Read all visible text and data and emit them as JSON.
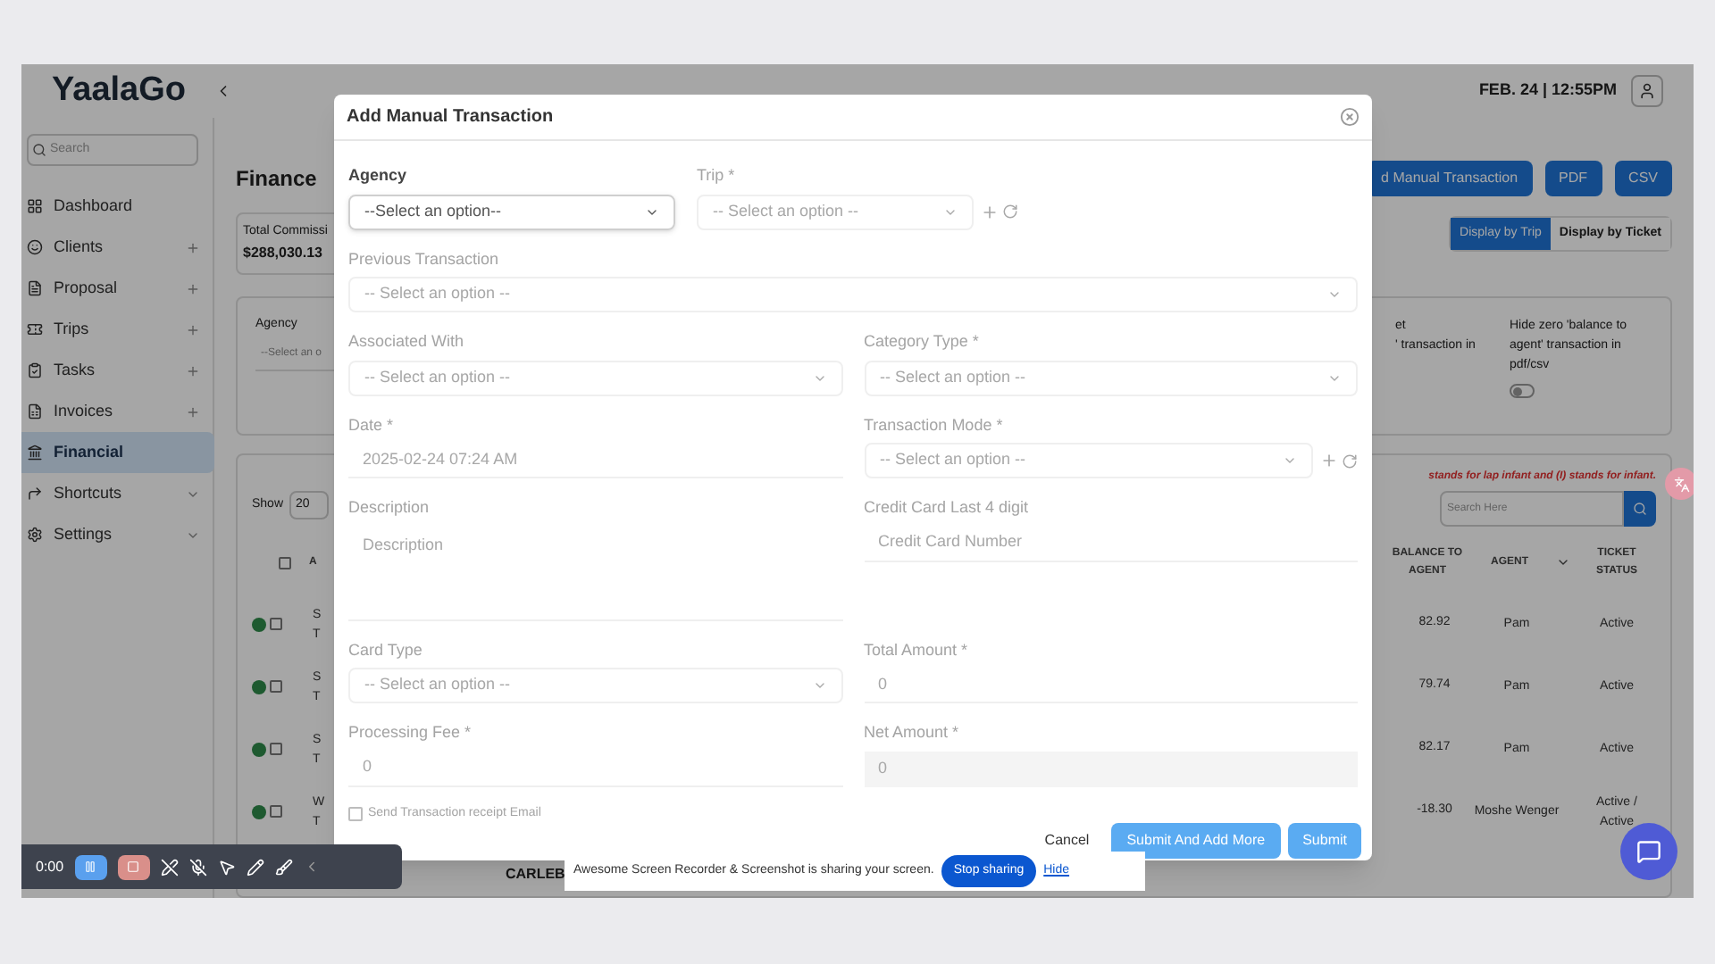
{
  "header": {
    "logo": "YaalaGo",
    "datetime": "FEB. 24 | 12:55PM"
  },
  "sidebar": {
    "search_placeholder": "Search",
    "items": [
      {
        "label": "Dashboard",
        "selected": false,
        "kind": "plain"
      },
      {
        "label": "Clients",
        "selected": false,
        "kind": "plus"
      },
      {
        "label": "Proposal",
        "selected": false,
        "kind": "plus"
      },
      {
        "label": "Trips",
        "selected": false,
        "kind": "plus"
      },
      {
        "label": "Tasks",
        "selected": false,
        "kind": "plus"
      },
      {
        "label": "Invoices",
        "selected": false,
        "kind": "plus"
      },
      {
        "label": "Financial",
        "selected": true,
        "kind": "plain"
      },
      {
        "label": "Shortcuts",
        "selected": false,
        "kind": "dropdown"
      },
      {
        "label": "Settings",
        "selected": false,
        "kind": "dropdown"
      }
    ]
  },
  "page": {
    "title": "Finance",
    "actions": [
      "d Manual Transaction",
      "PDF",
      "CSV"
    ],
    "stat": {
      "label": "Total Commissi",
      "value": "$288,030.13"
    },
    "display_tabs": [
      {
        "label": "Display by Trip",
        "selected": true
      },
      {
        "label": "Display by Ticket",
        "selected": false
      }
    ]
  },
  "filters": {
    "agency_label": "Agency",
    "agency_value": "--Select an o",
    "cut_note": [
      "et",
      "' transaction in"
    ],
    "hide_zero": {
      "label": "Hide zero 'balance to agent' transaction in pdf/csv",
      "on": false
    }
  },
  "table": {
    "show_label": "Show",
    "page_size": "20",
    "legend": "stands for lap infant and (I) stands for infant.",
    "search_placeholder": "Search Here",
    "header_checked": false,
    "columns": [
      "A",
      "BALANCE TO AGENT",
      "AGENT",
      "TICKET STATUS"
    ],
    "rows": [
      {
        "checked": false,
        "col_a": [
          "S",
          "T"
        ],
        "balance": "82.92",
        "agent": "Pam",
        "status": "Active"
      },
      {
        "checked": false,
        "col_a": [
          "S",
          "T"
        ],
        "balance": "79.74",
        "agent": "Pam",
        "status": "Active"
      },
      {
        "checked": false,
        "col_a": [
          "S",
          "T"
        ],
        "balance": "82.17",
        "agent": "Pam",
        "status": "Active"
      },
      {
        "checked": false,
        "col_a": [
          "W",
          "T"
        ],
        "balance": "-18.30",
        "agent": "Moshe Wenger",
        "status": "Active / Active"
      }
    ]
  },
  "modal": {
    "title": "Add Manual Transaction",
    "rows": [
      [
        {
          "label": "Agency",
          "kind": "select",
          "placeholder": "--Select an option--",
          "focused": true
        },
        {
          "label": "Trip *",
          "kind": "select",
          "placeholder": "-- Select an option --",
          "focused": false,
          "actions": true
        }
      ],
      [
        {
          "label": "Previous Transaction",
          "kind": "select",
          "placeholder": "-- Select an option --",
          "focused": false
        }
      ],
      [
        {
          "label": "Associated With",
          "kind": "select",
          "placeholder": "-- Select an option --",
          "focused": false
        },
        {
          "label": "Category Type *",
          "kind": "select",
          "placeholder": "-- Select an option --",
          "focused": false
        }
      ],
      [
        {
          "label": "Date *",
          "kind": "input",
          "value": "2025-02-24 07:24 AM",
          "focused": false
        },
        {
          "label": "Transaction Mode *",
          "kind": "select",
          "placeholder": "-- Select an option --",
          "focused": false,
          "actions": true
        }
      ],
      [
        {
          "label": "Description",
          "kind": "textarea",
          "placeholder": "Description",
          "focused": false
        },
        {
          "label": "Credit Card Last 4 digit",
          "kind": "input",
          "placeholder": "Credit Card Number",
          "focused": false
        }
      ],
      [
        {
          "label": "Card Type",
          "kind": "select",
          "placeholder": "-- Select an option --",
          "focused": false
        },
        {
          "label": "Total Amount *",
          "kind": "input",
          "value": "0",
          "focused": false
        }
      ],
      [
        {
          "label": "Processing Fee *",
          "kind": "input",
          "value": "0",
          "focused": false
        },
        {
          "label": "Net Amount *",
          "kind": "readonly",
          "value": "0",
          "focused": false
        }
      ]
    ],
    "email_checkbox": {
      "label": "Send Transaction receipt Email",
      "checked": false
    },
    "buttons": [
      "Cancel",
      "Submit And Add More",
      "Submit"
    ]
  },
  "footer_text": "CARLEB",
  "recorder": {
    "time": "0:00"
  },
  "share_bar": {
    "message": "Awesome Screen Recorder & Screenshot is sharing your screen.",
    "stop": "Stop sharing",
    "hide": "Hide"
  }
}
